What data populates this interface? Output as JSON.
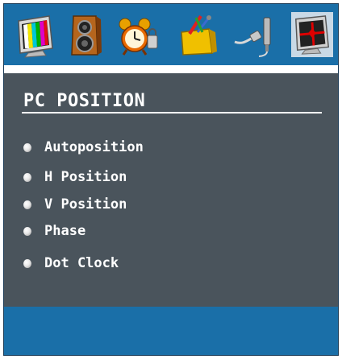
{
  "icons": [
    {
      "name": "picture-icon",
      "active": false
    },
    {
      "name": "sound-icon",
      "active": false
    },
    {
      "name": "timer-alarm-icon",
      "active": false
    },
    {
      "name": "setup-tools-icon",
      "active": false
    },
    {
      "name": "source-cable-icon",
      "active": false
    },
    {
      "name": "pc-position-icon",
      "active": true
    }
  ],
  "panel": {
    "title": "PC POSITION",
    "items": [
      {
        "label": "Autoposition"
      },
      {
        "label": "H Position"
      },
      {
        "label": "V Position"
      },
      {
        "label": "Phase"
      },
      {
        "label": "Dot Clock"
      }
    ]
  },
  "colors": {
    "icon_bar": "#1a6fa8",
    "panel_bg": "#4a545c",
    "text": "#ffffff",
    "active_icon_bg": "#c9d9e6"
  }
}
